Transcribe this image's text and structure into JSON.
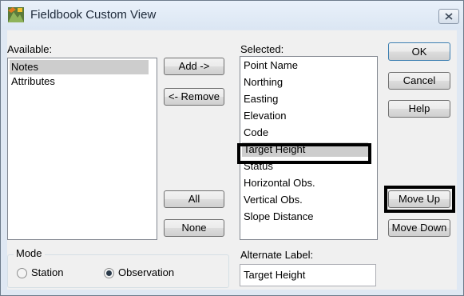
{
  "window": {
    "title": "Fieldbook Custom View"
  },
  "available": {
    "label": "Available:",
    "items": [
      "Notes",
      "Attributes"
    ],
    "selected_index": 0
  },
  "selected": {
    "label": "Selected:",
    "items": [
      "Point Name",
      "Northing",
      "Easting",
      "Elevation",
      "Code",
      "Target Height",
      "Status",
      "Horizontal Obs.",
      "Vertical Obs.",
      "Slope Distance"
    ],
    "selected_index": 5
  },
  "buttons": {
    "add": "Add ->",
    "remove": "<- Remove",
    "all": "All",
    "none": "None",
    "ok": "OK",
    "cancel": "Cancel",
    "help": "Help",
    "move_up": "Move Up",
    "move_down": "Move Down"
  },
  "mode": {
    "label": "Mode",
    "options": [
      "Station",
      "Observation"
    ],
    "selected": "Observation"
  },
  "alternate_label": {
    "label": "Alternate Label:",
    "value": "Target Height"
  }
}
